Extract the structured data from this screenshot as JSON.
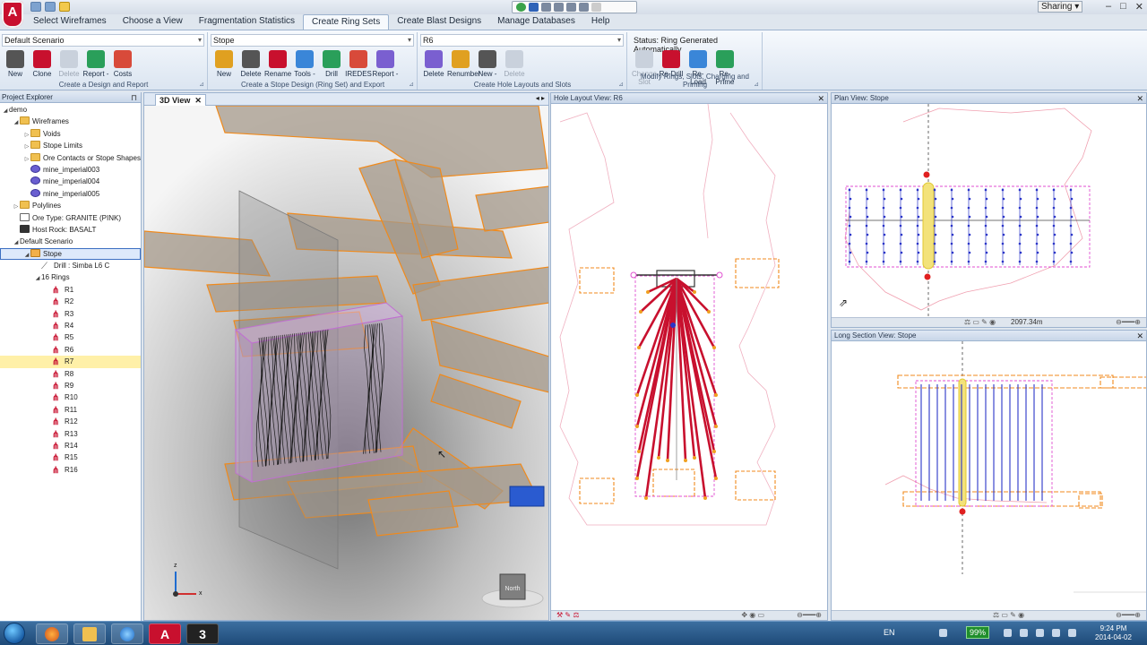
{
  "app": {
    "logo_letter": "A"
  },
  "ribbon_tabs": [
    "Select Wireframes",
    "Choose a View",
    "Fragmentation Statistics",
    "Create Ring Sets",
    "Create Blast Designs",
    "Manage Databases",
    "Help"
  ],
  "active_tab": "Create Ring Sets",
  "sharing_label": "Sharing",
  "ribbon": {
    "design_group": {
      "selector": "Default Scenario",
      "buttons": [
        {
          "label": "New",
          "icon": "new-design-icon",
          "enabled": true
        },
        {
          "label": "Clone",
          "icon": "clone-icon",
          "enabled": true
        },
        {
          "label": "Delete",
          "icon": "delete-icon",
          "enabled": false
        },
        {
          "label": "Report -",
          "icon": "report-icon",
          "enabled": true
        },
        {
          "label": "Costs",
          "icon": "costs-icon",
          "enabled": true
        }
      ],
      "caption": "Create a Design and Report"
    },
    "stope_group": {
      "selector": "Stope",
      "buttons": [
        {
          "label": "New",
          "icon": "new-ring-set-icon",
          "enabled": true
        },
        {
          "label": "Delete",
          "icon": "delete-ring-set-icon",
          "enabled": true
        },
        {
          "label": "Rename",
          "icon": "rename-icon",
          "enabled": true
        },
        {
          "label": "Tools -",
          "icon": "tools-icon",
          "enabled": true
        },
        {
          "label": "Drill",
          "icon": "drill-icon",
          "enabled": true
        },
        {
          "label": "IREDES",
          "icon": "iredes-icon",
          "enabled": true
        },
        {
          "label": "Report -",
          "icon": "report-icon",
          "enabled": true
        }
      ],
      "caption": "Create a Stope Design (Ring Set) and Export"
    },
    "ring_group": {
      "selector": "R6",
      "buttons": [
        {
          "label": "Delete",
          "icon": "delete-ring-icon",
          "enabled": true
        },
        {
          "label": "Renumber",
          "icon": "renumber-icon",
          "enabled": true
        },
        {
          "label": "New -",
          "icon": "new-hole-icon",
          "enabled": true
        },
        {
          "label": "Delete",
          "icon": "delete-hole-icon",
          "enabled": false
        }
      ],
      "caption": "Create Hole Layouts and Slots"
    },
    "modify_group": {
      "status": "Status: Ring Generated Automatically",
      "buttons": [
        {
          "label": "Change Slot",
          "icon": "change-slot-icon",
          "enabled": false
        },
        {
          "label": "Re-Drill",
          "icon": "re-drill-icon",
          "enabled": true
        },
        {
          "label": "Re-Load",
          "icon": "re-load-icon",
          "enabled": true
        },
        {
          "label": "Re-Prime",
          "icon": "re-prime-icon",
          "enabled": true
        }
      ],
      "caption": "Modify Rings, Slots, Charging and Priming"
    }
  },
  "explorer": {
    "title": "Project Explorer",
    "items": [
      {
        "label": "demo",
        "indent": 0,
        "twisty": "◢",
        "icon": ""
      },
      {
        "label": "Wireframes",
        "indent": 1,
        "twisty": "◢",
        "icon": "folder"
      },
      {
        "label": "Voids",
        "indent": 2,
        "twisty": "▷",
        "icon": "folder"
      },
      {
        "label": "Stope Limits",
        "indent": 2,
        "twisty": "▷",
        "icon": "folder"
      },
      {
        "label": "Ore Contacts or Stope Shapes",
        "indent": 2,
        "twisty": "▷",
        "icon": "folder"
      },
      {
        "label": "mine_imperial003",
        "indent": 2,
        "twisty": "",
        "icon": "wire"
      },
      {
        "label": "mine_imperial004",
        "indent": 2,
        "twisty": "",
        "icon": "wire"
      },
      {
        "label": "mine_imperial005",
        "indent": 2,
        "twisty": "",
        "icon": "wire"
      },
      {
        "label": "Polylines",
        "indent": 1,
        "twisty": "▷",
        "icon": "folder"
      },
      {
        "label": "Ore Type: GRANITE (PINK)",
        "indent": 1,
        "twisty": "",
        "icon": "ore"
      },
      {
        "label": "Host Rock: BASALT",
        "indent": 1,
        "twisty": "",
        "icon": "rock"
      },
      {
        "label": "Default Scenario",
        "indent": 1,
        "twisty": "◢",
        "icon": ""
      },
      {
        "label": "Stope",
        "indent": 2,
        "twisty": "◢",
        "icon": "stope",
        "state": "box"
      },
      {
        "label": "Drill : Simba L6 C",
        "indent": 3,
        "twisty": "",
        "icon": "drill"
      },
      {
        "label": "16 Rings",
        "indent": 3,
        "twisty": "◢",
        "icon": ""
      },
      {
        "label": "R1",
        "indent": 4,
        "twisty": "",
        "icon": "ring"
      },
      {
        "label": "R2",
        "indent": 4,
        "twisty": "",
        "icon": "ring"
      },
      {
        "label": "R3",
        "indent": 4,
        "twisty": "",
        "icon": "ring"
      },
      {
        "label": "R4",
        "indent": 4,
        "twisty": "",
        "icon": "ring"
      },
      {
        "label": "R5",
        "indent": 4,
        "twisty": "",
        "icon": "ring"
      },
      {
        "label": "R6",
        "indent": 4,
        "twisty": "",
        "icon": "ring"
      },
      {
        "label": "R7",
        "indent": 4,
        "twisty": "",
        "icon": "ring",
        "state": "sel"
      },
      {
        "label": "R8",
        "indent": 4,
        "twisty": "",
        "icon": "ring"
      },
      {
        "label": "R9",
        "indent": 4,
        "twisty": "",
        "icon": "ring"
      },
      {
        "label": "R10",
        "indent": 4,
        "twisty": "",
        "icon": "ring"
      },
      {
        "label": "R11",
        "indent": 4,
        "twisty": "",
        "icon": "ring"
      },
      {
        "label": "R12",
        "indent": 4,
        "twisty": "",
        "icon": "ring"
      },
      {
        "label": "R13",
        "indent": 4,
        "twisty": "",
        "icon": "ring"
      },
      {
        "label": "R14",
        "indent": 4,
        "twisty": "",
        "icon": "ring"
      },
      {
        "label": "R15",
        "indent": 4,
        "twisty": "",
        "icon": "ring"
      },
      {
        "label": "R16",
        "indent": 4,
        "twisty": "",
        "icon": "ring"
      }
    ]
  },
  "view3d": {
    "tab": "3D View",
    "axis_z": "z",
    "axis_x": "x",
    "cube_label": "North"
  },
  "hole_layout": {
    "title": "Hole Layout View: R6"
  },
  "plan_view": {
    "title": "Plan View: Stope",
    "scale_text": "2097.34m"
  },
  "long_section": {
    "title": "Long Section View: Stope"
  },
  "taskbar": {
    "app3_label": "3",
    "lang": "EN",
    "battery": "99%",
    "time": "9:24 PM",
    "date": "2014-04-02"
  },
  "colors": {
    "accent": "#c8102e",
    "drift_orange": "#f08a1c",
    "ring_red": "#c8102e",
    "hole_blue": "#2b35c8",
    "outline_pink": "#e04fd0"
  }
}
